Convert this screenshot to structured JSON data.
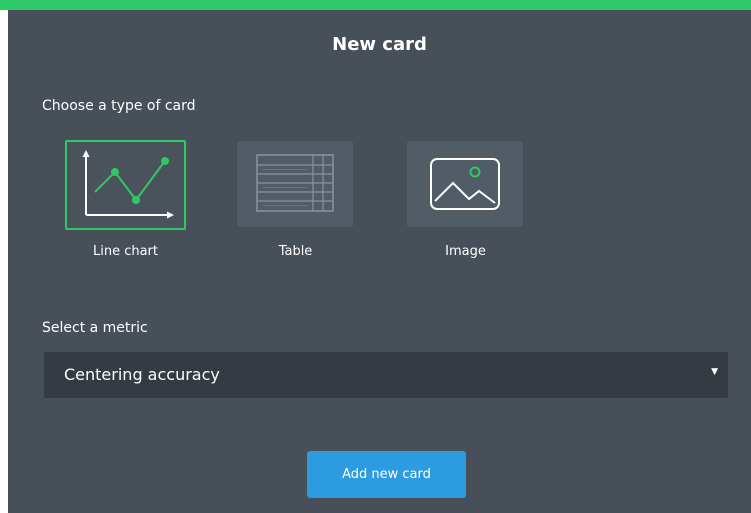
{
  "dialog": {
    "title": "New card",
    "type_prompt": "Choose a type of card",
    "card_types": [
      {
        "label": "Line chart",
        "icon": "line-chart-icon",
        "selected": true
      },
      {
        "label": "Table",
        "icon": "table-icon",
        "selected": false
      },
      {
        "label": "Image",
        "icon": "image-icon",
        "selected": false
      }
    ],
    "metric_prompt": "Select a metric",
    "metric_selected": "Centering accuracy",
    "submit_label": "Add new card"
  },
  "colors": {
    "accent": "#2ec866",
    "button": "#2d9be0",
    "dialog_background": "#474f59",
    "select_background": "#353b43"
  }
}
